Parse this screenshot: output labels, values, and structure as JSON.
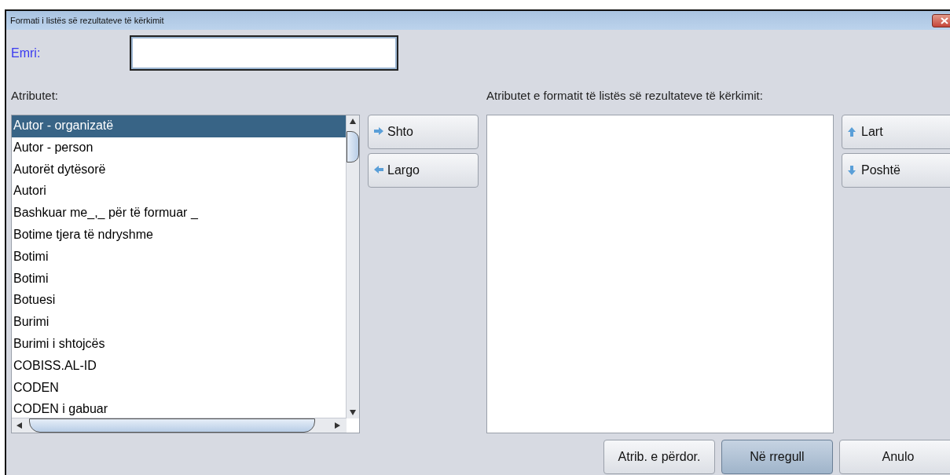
{
  "window": {
    "title": "Formati i listës së rezultateve të kërkimit"
  },
  "name_field": {
    "label": "Emri:"
  },
  "attributes": {
    "label": "Atributet:",
    "items": [
      {
        "text": "Autor - organizatë",
        "selected": true
      },
      {
        "text": "Autor - person",
        "selected": false
      },
      {
        "text": "Autorët dytësorë",
        "selected": false
      },
      {
        "text": "Autori",
        "selected": false
      },
      {
        "text": "Bashkuar me_,_ për të formuar _",
        "selected": false
      },
      {
        "text": "Botime tjera të ndryshme",
        "selected": false
      },
      {
        "text": "Botimi",
        "selected": false
      },
      {
        "text": "Botimi",
        "selected": false
      },
      {
        "text": "Botuesi",
        "selected": false
      },
      {
        "text": "Burimi",
        "selected": false
      },
      {
        "text": "Burimi i shtojcës",
        "selected": false
      },
      {
        "text": "COBISS.AL-ID",
        "selected": false
      },
      {
        "text": "CODEN",
        "selected": false
      },
      {
        "text": "CODEN i gabuar",
        "selected": false
      }
    ]
  },
  "transfer_buttons": [
    {
      "label": "Shto",
      "kind": "add"
    },
    {
      "label": "Largo",
      "kind": "remove"
    }
  ],
  "format_attributes": {
    "label": "Atributet e formatit të listës së rezultateve të kërkimit:"
  },
  "order_buttons": [
    {
      "label": "Lart",
      "kind": "up"
    },
    {
      "label": "Poshtë",
      "kind": "down"
    }
  ],
  "footer_buttons": [
    {
      "label": "Atrib. e përdor.",
      "default": false
    },
    {
      "label": "Në rregull",
      "default": true
    },
    {
      "label": "Anulo",
      "default": false
    }
  ]
}
